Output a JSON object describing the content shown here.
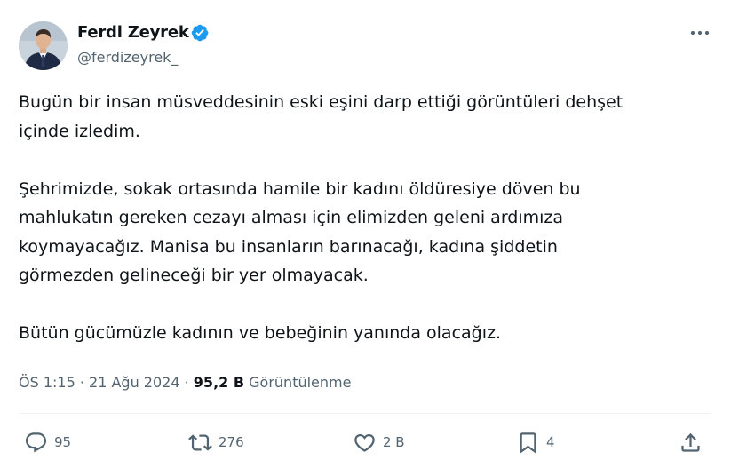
{
  "author": {
    "display_name": "Ferdi Zeyrek",
    "handle": "@ferdizeyrek_",
    "verified": true
  },
  "tweet": {
    "paragraphs": [
      [
        "Bugün bir insan müsveddesinin eski eşini darp ettiği görüntüleri dehşet",
        "içinde izledim."
      ],
      [
        "Şehrimizde, sokak ortasında hamile bir kadını öldüresiye döven bu",
        "mahlukatın gereken cezayı alması için elimizden geleni ardımıza",
        "koymayacağız. Manisa bu insanların barınacağı, kadına şiddetin",
        "görmezden gelineceği bir yer olmayacak."
      ],
      [
        "Bütün gücümüzle kadının ve bebeğinin yanında olacağız."
      ]
    ]
  },
  "meta": {
    "time": "ÖS 1:15",
    "separator": " · ",
    "date": "21 Ağu 2024",
    "views_count": "95,2 B",
    "views_label": "Görüntülenme"
  },
  "actions": {
    "replies": "95",
    "retweets": "276",
    "likes": "2 B",
    "bookmarks": "4"
  },
  "icons": {
    "more": "more-horizontal-icon",
    "verified": "verified-badge-icon",
    "reply": "reply-icon",
    "retweet": "retweet-icon",
    "like": "heart-icon",
    "bookmark": "bookmark-icon",
    "share": "share-icon"
  },
  "colors": {
    "text": "#0f1419",
    "secondary": "#536471",
    "verified": "#1d9bf0",
    "divider": "#eff3f4"
  }
}
